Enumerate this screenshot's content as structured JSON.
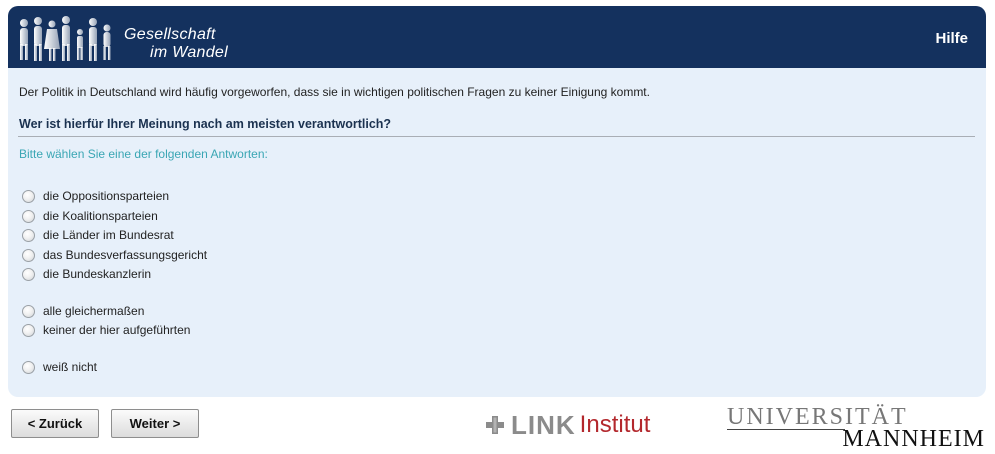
{
  "header": {
    "logo_line1": "Gesellschaft",
    "logo_line2": "im Wandel",
    "help_label": "Hilfe"
  },
  "survey": {
    "intro": "Der Politik in Deutschland wird häufig vorgeworfen, dass sie in wichtigen politischen Fragen zu keiner Einigung kommt.",
    "question": "Wer ist hierfür Ihrer Meinung nach am meisten verantwortlich?",
    "instruction": "Bitte wählen Sie eine der folgenden Antworten:",
    "options": [
      "die Oppositionsparteien",
      "die Koalitionsparteien",
      "die Länder im Bundesrat",
      "das Bundesverfassungsgericht",
      "die Bundeskanzlerin",
      "alle gleichermaßen",
      "keiner der hier aufgeführten",
      "weiß nicht"
    ]
  },
  "nav": {
    "back_label": "< Zurück",
    "next_label": "Weiter >"
  },
  "footer": {
    "link_word": "LINK",
    "institut_word": "Institut",
    "uni_line1": "UNIVERSITÄT",
    "uni_line2": "MANNHEIM"
  },
  "colors": {
    "header_bg": "#14315e",
    "panel_bg": "#e7f0fa",
    "instruction": "#3aa6b4",
    "institut_red": "#b3282d"
  }
}
